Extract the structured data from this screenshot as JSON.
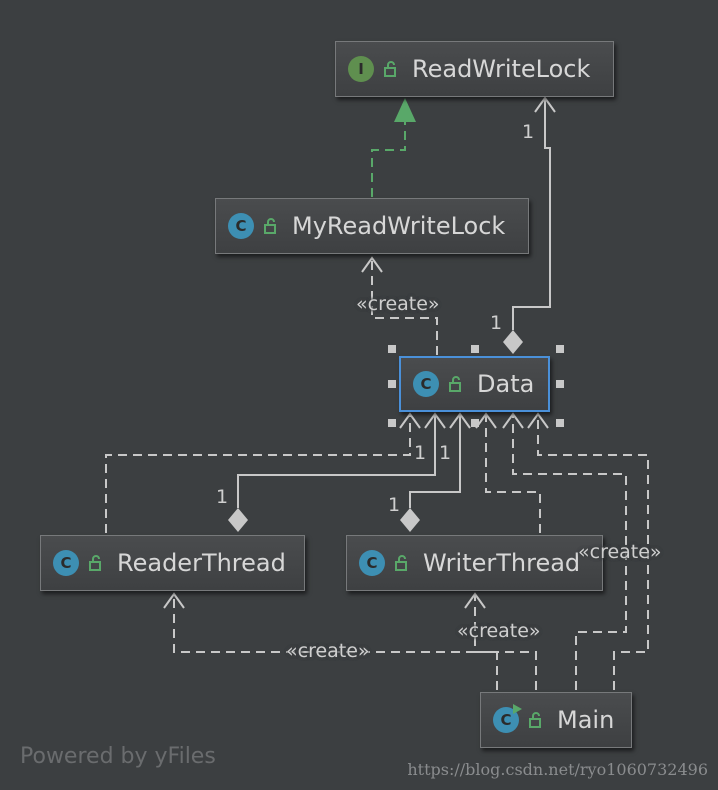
{
  "nodes": {
    "readwritelock": {
      "name": "ReadWriteLock",
      "kind": "interface",
      "badge": "I"
    },
    "myreadwritelock": {
      "name": "MyReadWriteLock",
      "kind": "class",
      "badge": "C"
    },
    "data": {
      "name": "Data",
      "kind": "class",
      "badge": "C",
      "selected": true
    },
    "readerthread": {
      "name": "ReaderThread",
      "kind": "class",
      "badge": "C"
    },
    "writerthread": {
      "name": "WriterThread",
      "kind": "class",
      "badge": "C"
    },
    "main": {
      "name": "Main",
      "kind": "class",
      "badge": "C",
      "runnable": true
    }
  },
  "labels": {
    "create_mydata": "«create»",
    "create_main_data": "«create»",
    "create_main_writer": "«create»",
    "create_main_reader": "«create»",
    "mult_rwl_top": "1",
    "mult_rwl_data": "1",
    "mult_data_reader": "1",
    "mult_data_writer": "1",
    "mult_reader": "1",
    "mult_writer": "1"
  },
  "footer": {
    "powered_by": "Powered by yFiles",
    "watermark": "https://blog.csdn.net/ryo1060732496"
  },
  "colors": {
    "background": "#3c3f41",
    "edge": "#c8c8c8",
    "realization": "#59a869",
    "selection": "#4a90d9",
    "interface_badge": "#5f8f4f",
    "class_badge": "#3d8fb3"
  }
}
